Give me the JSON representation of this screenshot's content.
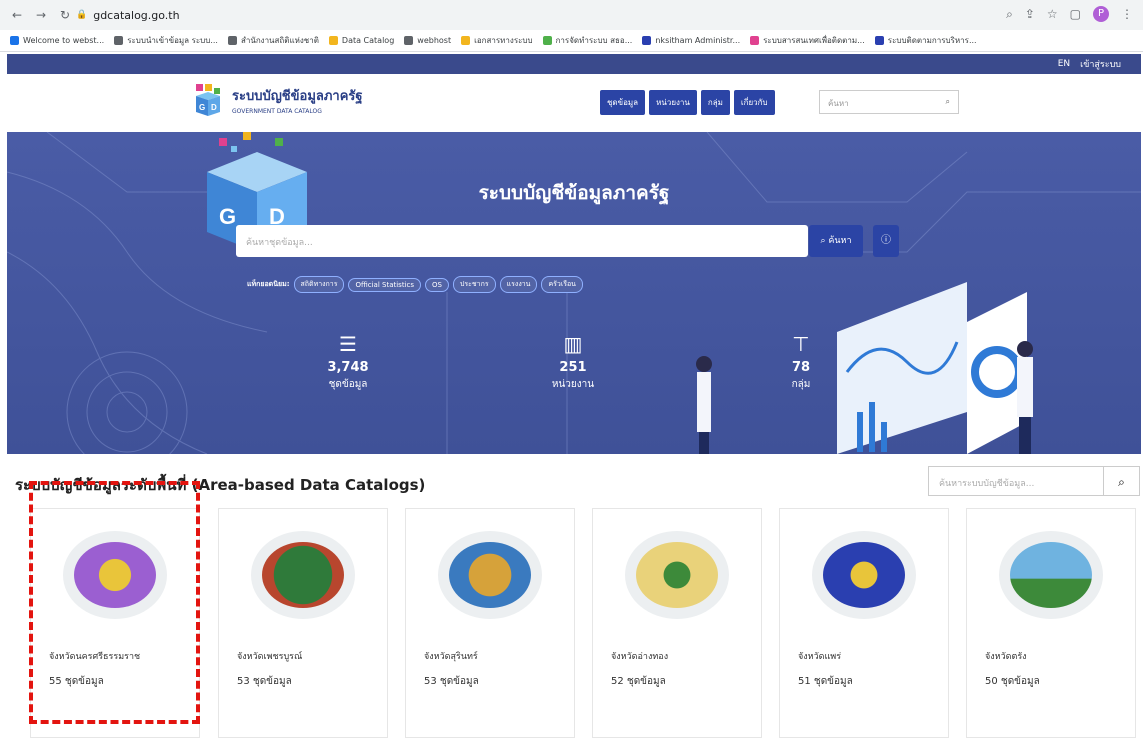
{
  "browser": {
    "url": "gdcatalog.go.th",
    "profile_initial": "P",
    "bookmarks": [
      "Welcome to webst...",
      "ระบบนำเข้าข้อมูล ระบบ...",
      "สำนักงานสถิติแห่งชาติ",
      "Data Catalog",
      "webhost",
      "เอกสารทางระบบ",
      "การจัดทำระบบ สธอ...",
      "nksitham Administr...",
      "ระบบสารสนเทศเพื่อติดตาม...",
      "ระบบติดตามการบริหาร..."
    ]
  },
  "topbar": {
    "lang": "EN",
    "login": "เข้าสู่ระบบ"
  },
  "header": {
    "logo_title": "ระบบบัญชีข้อมูลภาครัฐ",
    "logo_sub": "GOVERNMENT DATA CATALOG",
    "menu": [
      "ชุดข้อมูล",
      "หน่วยงาน",
      "กลุ่ม",
      "เกี่ยวกับ"
    ],
    "search_placeholder": "ค้นหา"
  },
  "hero": {
    "title": "ระบบบัญชีข้อมูลภาครัฐ",
    "search_placeholder": "ค้นหาชุดข้อมูล...",
    "search_button": "ค้นหา",
    "tags_label": "แท็กยอดนิยม:",
    "tags": [
      "สถิติทางการ",
      "Official Statistics",
      "OS",
      "ประชากร",
      "แรงงาน",
      "ครัวเรือน"
    ],
    "stats": [
      {
        "icon": "database-icon",
        "value": "3,748",
        "label": "ชุดข้อมูล"
      },
      {
        "icon": "building-icon",
        "value": "251",
        "label": "หน่วยงาน"
      },
      {
        "icon": "sitemap-icon",
        "value": "78",
        "label": "กลุ่ม"
      }
    ]
  },
  "section": {
    "title": "ระบบบัญชีข้อมูลระดับพื้นที่ (Area-based Data Catalogs)",
    "search_placeholder": "ค้นหาระบบบัญชีข้อมูล..."
  },
  "cards": [
    {
      "name": "จังหวัดนครศรีธรรมราช",
      "count": "55 ชุดข้อมูล",
      "color": "#9b5fd1",
      "accent": "#e9c53a"
    },
    {
      "name": "จังหวัดเพชรบูรณ์",
      "count": "53 ชุดข้อมูล",
      "color": "#2f7a3a",
      "accent": "#b8462e"
    },
    {
      "name": "จังหวัดสุรินทร์",
      "count": "53 ชุดข้อมูล",
      "color": "#3a7abf",
      "accent": "#d6a23a"
    },
    {
      "name": "จังหวัดอ่างทอง",
      "count": "52 ชุดข้อมูล",
      "color": "#e9d27a",
      "accent": "#3d8a3a"
    },
    {
      "name": "จังหวัดแพร่",
      "count": "51 ชุดข้อมูล",
      "color": "#2a3fb0",
      "accent": "#e8c53a"
    },
    {
      "name": "จังหวัดตรัง",
      "count": "50 ชุดข้อมูล",
      "color": "#6fb3e0",
      "accent": "#3d8a3a"
    }
  ]
}
